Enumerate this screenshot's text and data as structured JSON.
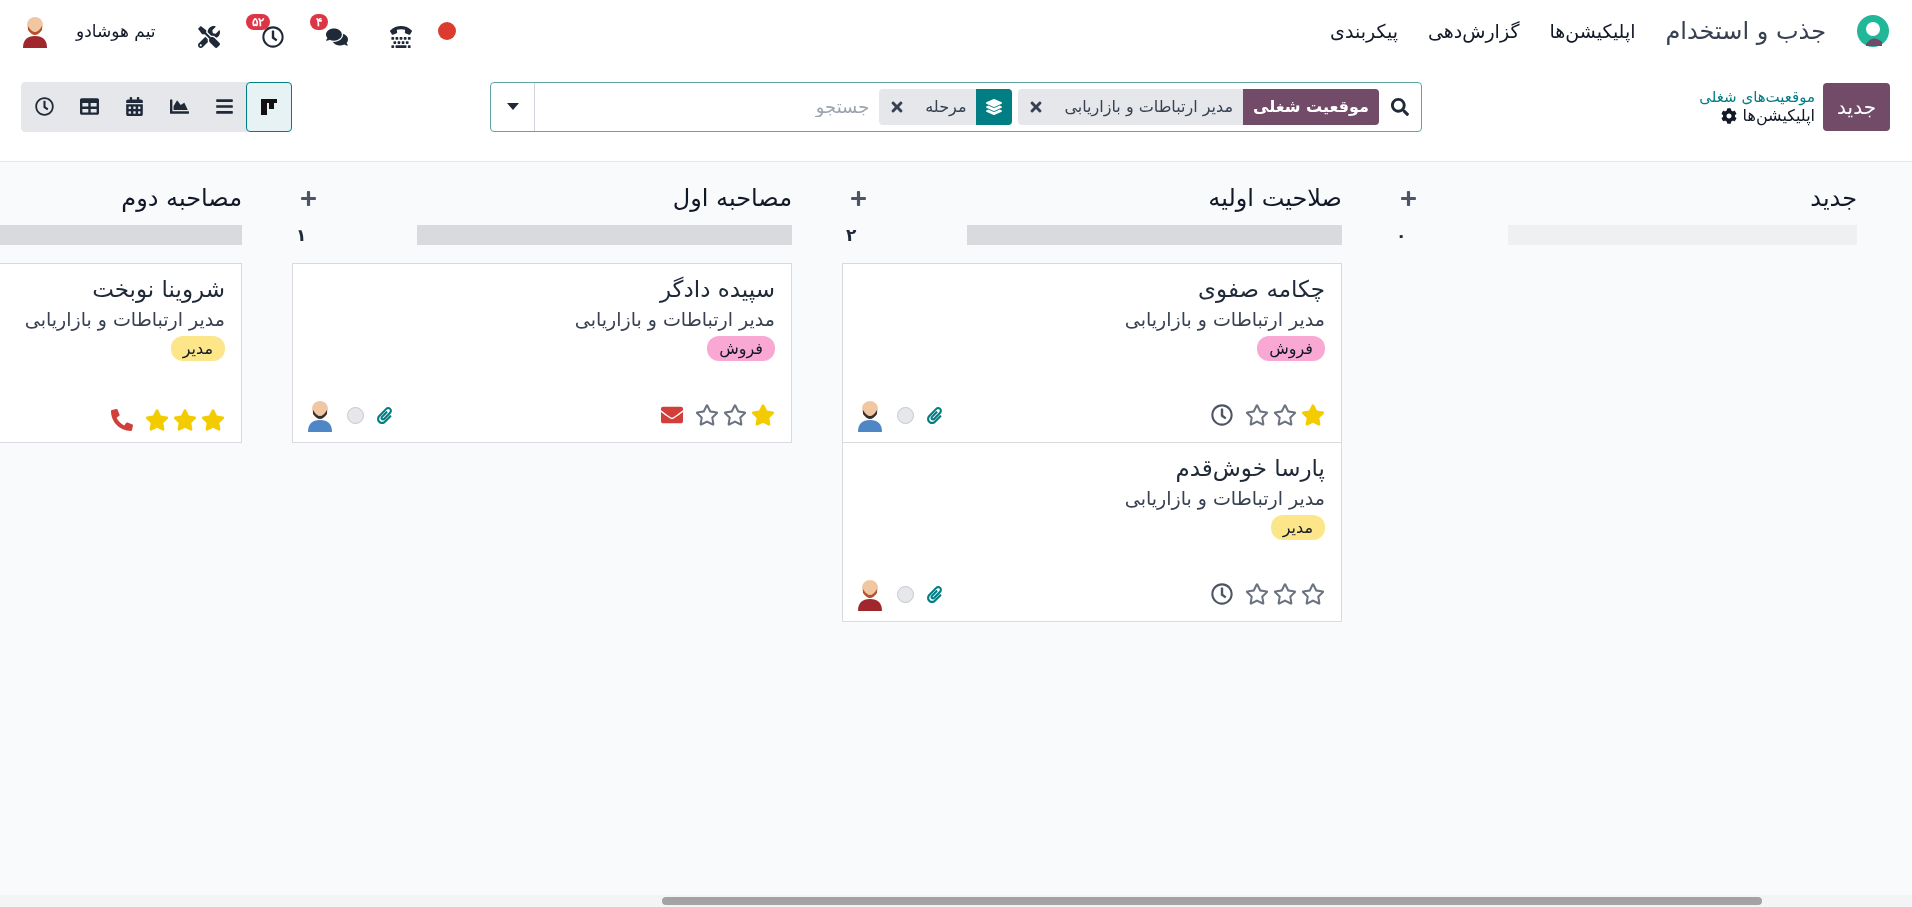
{
  "navbar": {
    "app_name": "جذب و استخدام",
    "menu": [
      "اپلیکیشن‌ها",
      "گزارش‌دهی",
      "پیکربندی"
    ],
    "systray": [
      {
        "kind": "record"
      },
      {
        "kind": "phone"
      },
      {
        "kind": "chat",
        "badge": "۴"
      },
      {
        "kind": "activity",
        "badge": "۵۲"
      },
      {
        "kind": "tools"
      }
    ],
    "user": "تیم هوشادو"
  },
  "control_panel": {
    "new_button": "جدید",
    "breadcrumb": {
      "parent": "موقعیت‌های شغلی",
      "current": "اپلیکیشن‌ها"
    },
    "search": {
      "facets": [
        {
          "kind": "field",
          "label": "موقعیت شغلی",
          "value": "مدیر ارتباطات و بازاریابی"
        },
        {
          "kind": "group",
          "value": "مرحله"
        }
      ],
      "placeholder": "جستجو"
    },
    "views": [
      {
        "kind": "kanban",
        "selected": true
      },
      {
        "kind": "list",
        "selected": false
      },
      {
        "kind": "graph",
        "selected": false
      },
      {
        "kind": "calendar",
        "selected": false
      },
      {
        "kind": "pivot",
        "selected": false
      },
      {
        "kind": "activity",
        "selected": false
      }
    ]
  },
  "columns": [
    {
      "title": "جدید",
      "count": "۰",
      "level": 0
    },
    {
      "title": "صلاحیت اولیه",
      "count": "۲",
      "level": 1,
      "cards": [
        {
          "name": "چکامه صفوی",
          "job": "مدیر ارتباطات و بازاریابی",
          "tag": {
            "label": "فروش",
            "color": "#f9a8d4"
          },
          "stars": 1,
          "activity": {
            "kind": "clock"
          },
          "avatar": {
            "kind": "bun"
          }
        },
        {
          "name": "پارسا خوش‌قدم",
          "job": "مدیر ارتباطات و بازاریابی",
          "tag": {
            "label": "مدیر",
            "color": "#fde68a"
          },
          "stars": 0,
          "activity": {
            "kind": "clock"
          },
          "avatar": {
            "kind": "beard"
          }
        }
      ]
    },
    {
      "title": "مصاحبه اول",
      "count": "۱",
      "level": 1,
      "cards": [
        {
          "name": "سپیده دادگر",
          "job": "مدیر ارتباطات و بازاریابی",
          "tag": {
            "label": "فروش",
            "color": "#f9a8d4"
          },
          "stars": 1,
          "activity": {
            "kind": "mail"
          },
          "avatar": {
            "kind": "bun"
          }
        }
      ]
    },
    {
      "title": "مصاحبه دوم",
      "level": 1,
      "cards": [
        {
          "name": "شروینا نوبخت",
          "job": "مدیر ارتباطات و بازاریابی",
          "tag": {
            "label": "مدیر",
            "color": "#fde68a"
          },
          "stars": 3,
          "activity": {
            "kind": "phone"
          }
        }
      ]
    }
  ]
}
